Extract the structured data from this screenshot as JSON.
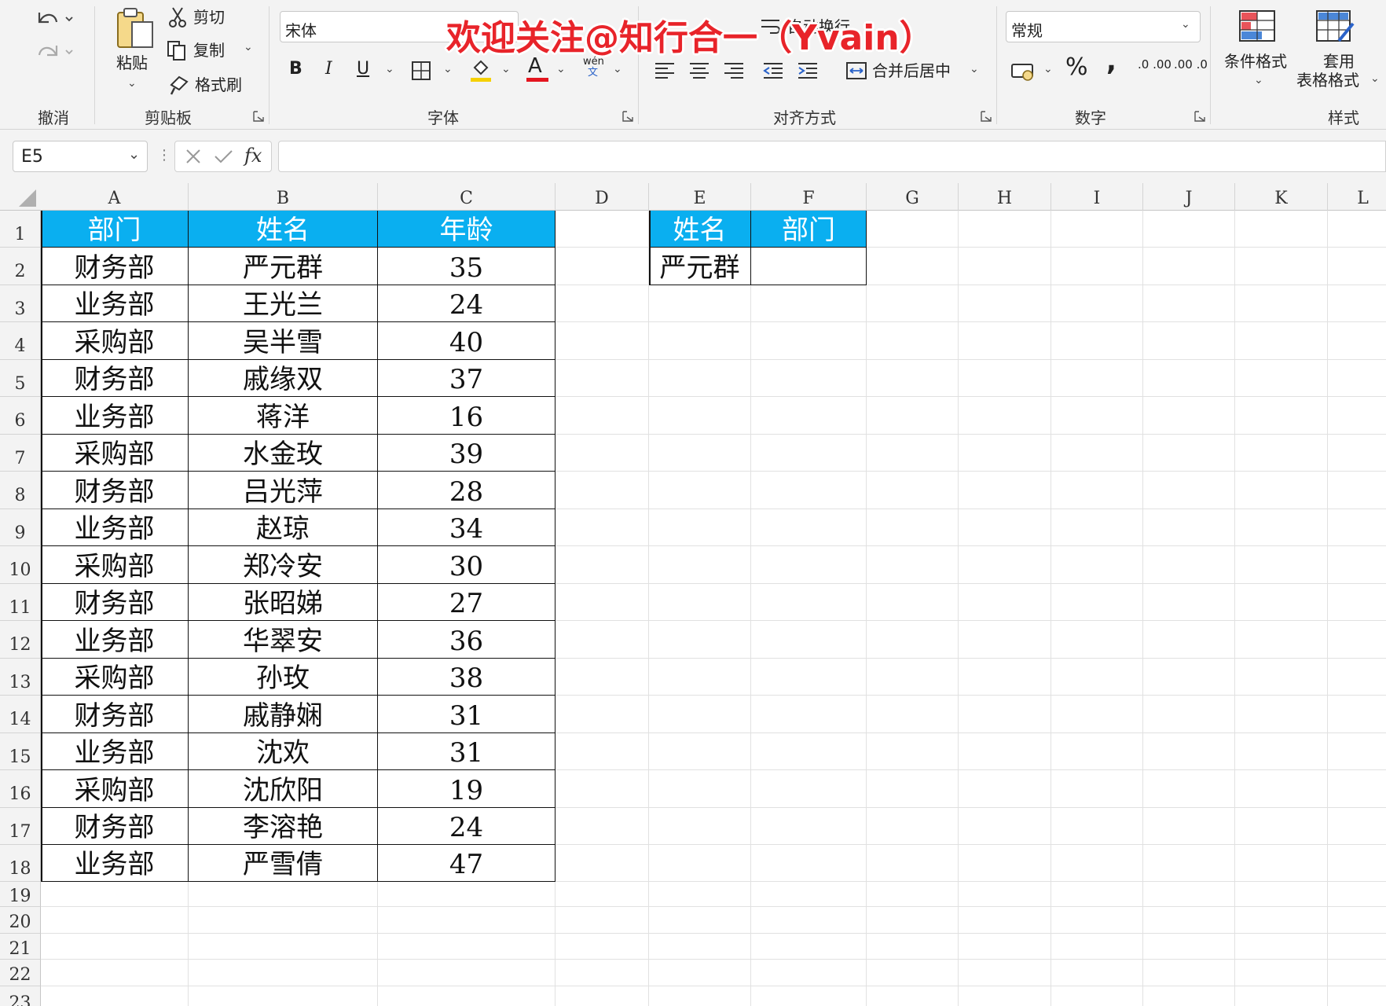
{
  "ribbon": {
    "undo_group": "撤消",
    "clipboard": {
      "paste": "粘贴",
      "cut": "剪切",
      "copy": "复制",
      "format_painter": "格式刷",
      "group": "剪贴板"
    },
    "font": {
      "name": "宋体",
      "bold": "B",
      "italic": "I",
      "underline": "U",
      "font_color_glyph": "A",
      "phonetic_top": "wén",
      "phonetic_bottom": "文",
      "group": "字体"
    },
    "alignment": {
      "wrap_text": "自动换行",
      "merge_center": "合并后居中",
      "group": "对齐方式"
    },
    "number": {
      "format": "常规",
      "percent": "%",
      "comma": ",",
      "inc_decimal": ".0 .00",
      "dec_decimal": ".00 .0",
      "group": "数字"
    },
    "styles": {
      "conditional": "条件格式",
      "table_format_1": "套用",
      "table_format_2": "表格格式",
      "group": "样式"
    }
  },
  "watermark": "欢迎关注@知行合一（Yvain）",
  "formula_bar": {
    "name_box": "E5",
    "fx": "fx",
    "formula": ""
  },
  "columns": [
    "A",
    "B",
    "C",
    "D",
    "E",
    "F",
    "G",
    "H",
    "I",
    "J",
    "K",
    "L"
  ],
  "rows": [
    "1",
    "2",
    "3",
    "4",
    "5",
    "6",
    "7",
    "8",
    "9",
    "10",
    "11",
    "12",
    "13",
    "14",
    "15",
    "16",
    "17",
    "18",
    "19",
    "20",
    "21",
    "22",
    "23"
  ],
  "table": {
    "headers": [
      "部门",
      "姓名",
      "年龄"
    ],
    "data": [
      [
        "财务部",
        "严元群",
        "35"
      ],
      [
        "业务部",
        "王光兰",
        "24"
      ],
      [
        "采购部",
        "吴半雪",
        "40"
      ],
      [
        "财务部",
        "戚缘双",
        "37"
      ],
      [
        "业务部",
        "蒋洋",
        "16"
      ],
      [
        "采购部",
        "水金玫",
        "39"
      ],
      [
        "财务部",
        "吕光萍",
        "28"
      ],
      [
        "业务部",
        "赵琼",
        "34"
      ],
      [
        "采购部",
        "郑冷安",
        "30"
      ],
      [
        "财务部",
        "张昭娣",
        "27"
      ],
      [
        "业务部",
        "华翠安",
        "36"
      ],
      [
        "采购部",
        "孙玫",
        "38"
      ],
      [
        "财务部",
        "戚静娴",
        "31"
      ],
      [
        "业务部",
        "沈欢",
        "31"
      ],
      [
        "采购部",
        "沈欣阳",
        "19"
      ],
      [
        "财务部",
        "李溶艳",
        "24"
      ],
      [
        "业务部",
        "严雪倩",
        "47"
      ]
    ]
  },
  "lookup": {
    "headers": [
      "姓名",
      "部门"
    ],
    "values": [
      "严元群",
      ""
    ]
  },
  "colors": {
    "header_fill": "#0aaff0",
    "header_text": "#ffffff",
    "watermark": "#e8242a"
  }
}
